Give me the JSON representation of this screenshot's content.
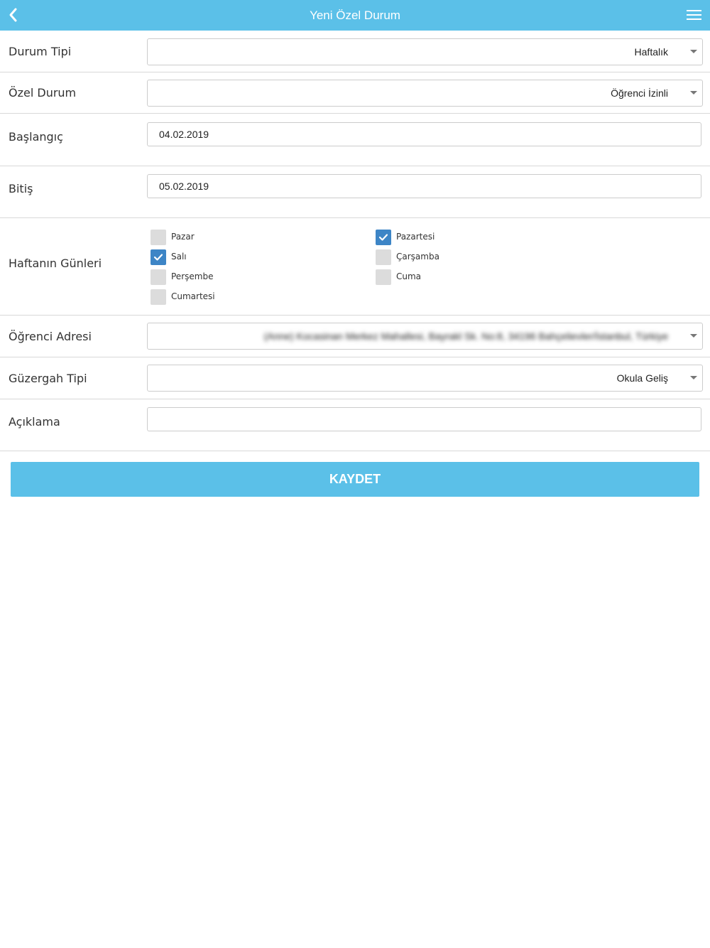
{
  "header": {
    "title": "Yeni Özel Durum",
    "back_icon": "chevron-left-icon",
    "menu_icon": "hamburger-menu-icon",
    "color": "#5bc0e8"
  },
  "form": {
    "durum_tipi": {
      "label": "Durum Tipi",
      "value": "Haftalık"
    },
    "ozel_durum": {
      "label": "Özel Durum",
      "value": "Öğrenci İzinli"
    },
    "baslangic": {
      "label": "Başlangıç",
      "value": "04.02.2019"
    },
    "bitis": {
      "label": "Bitiş",
      "value": "05.02.2019"
    },
    "gunler": {
      "label": "Haftanın Günleri",
      "days": [
        {
          "label": "Pazar",
          "checked": false
        },
        {
          "label": "Pazartesi",
          "checked": true
        },
        {
          "label": "Salı",
          "checked": true
        },
        {
          "label": "Çarşamba",
          "checked": false
        },
        {
          "label": "Perşembe",
          "checked": false
        },
        {
          "label": "Cuma",
          "checked": false
        },
        {
          "label": "Cumartesi",
          "checked": false
        }
      ]
    },
    "ogrenci_adresi": {
      "label": "Öğrenci Adresi",
      "value": "(Anne) Kocasinan Merkez Mahallesi, Bayrakl Sk. No:8, 34196 Bahçelievler/İstanbul, Türkiye"
    },
    "guzergah_tipi": {
      "label": "Güzergah Tipi",
      "value": "Okula Geliş"
    },
    "aciklama": {
      "label": "Açıklama",
      "value": ""
    }
  },
  "actions": {
    "save_label": "KAYDET"
  },
  "colors": {
    "checkbox_checked": "#3d85c6",
    "checkbox_unchecked": "#dcdcdc"
  }
}
